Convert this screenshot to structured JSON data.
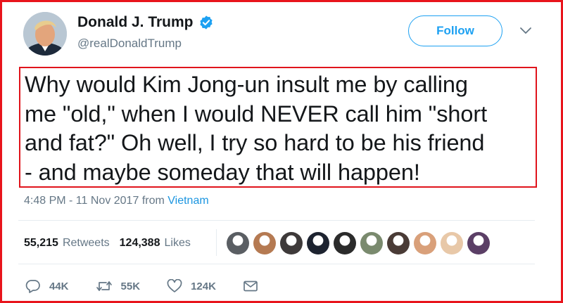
{
  "user": {
    "name": "Donald J. Trump",
    "handle": "@realDonaldTrump",
    "verified": true
  },
  "header": {
    "follow_label": "Follow"
  },
  "tweet": {
    "text": "Why would Kim Jong-un insult me by calling\nme \"old,\" when I would NEVER call him \"short\nand fat?\" Oh well, I try so hard to be his friend\n- and maybe someday that will happen!",
    "timestamp": "4:48 PM - 11 Nov 2017",
    "from_label": "from",
    "location": "Vietnam"
  },
  "stats": {
    "retweets_count": "55,215",
    "retweets_label": "Retweets",
    "likes_count": "124,388",
    "likes_label": "Likes"
  },
  "likers": [
    {
      "name": "liker-avatar-1",
      "color": "#5a5e63"
    },
    {
      "name": "liker-avatar-2",
      "color": "#b57a52"
    },
    {
      "name": "liker-avatar-3",
      "color": "#3e3a3a"
    },
    {
      "name": "liker-avatar-4",
      "color": "#1d2330"
    },
    {
      "name": "liker-avatar-5",
      "color": "#2b2b2b"
    },
    {
      "name": "liker-avatar-6",
      "color": "#7a8a6e"
    },
    {
      "name": "liker-avatar-7",
      "color": "#4a3b36"
    },
    {
      "name": "liker-avatar-8",
      "color": "#d9a07a"
    },
    {
      "name": "liker-avatar-9",
      "color": "#e8c8a8"
    },
    {
      "name": "liker-avatar-10",
      "color": "#5b3f66"
    }
  ],
  "actions": {
    "reply_count": "44K",
    "retweet_count": "55K",
    "like_count": "124K"
  },
  "colors": {
    "accent": "#1da1f2",
    "highlight_border": "#e0141c",
    "text": "#14171a",
    "muted": "#657786"
  },
  "icons": {
    "verified": "verified-badge-icon",
    "caret": "chevron-down-icon",
    "reply": "reply-icon",
    "retweet": "retweet-icon",
    "like": "heart-icon",
    "dm": "envelope-icon"
  }
}
